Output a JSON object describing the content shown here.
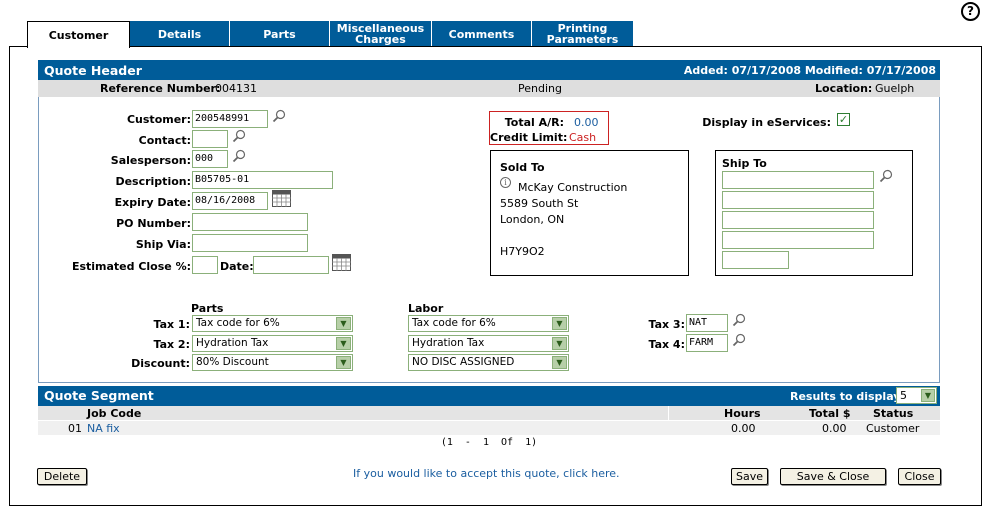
{
  "help_icon": "?",
  "tabs": [
    {
      "label": "Customer",
      "active": true
    },
    {
      "label": "Details",
      "active": false
    },
    {
      "label": "Parts",
      "active": false
    },
    {
      "label": "Miscellaneous\nCharges",
      "active": false
    },
    {
      "label": "Comments",
      "active": false
    },
    {
      "label": "Printing\nParameters",
      "active": false
    }
  ],
  "header": {
    "title": "Quote Header",
    "added_label": "Added:",
    "added_value": "07/17/2008",
    "modified_label": "Modified:",
    "modified_value": "07/17/2008",
    "reference_label": "Reference Number:",
    "reference_value": "004131",
    "status": "Pending",
    "location_label": "Location:",
    "location_value": "Guelph"
  },
  "form": {
    "customer_label": "Customer:",
    "customer_value": "200548991",
    "contact_label": "Contact:",
    "contact_value": "",
    "salesperson_label": "Salesperson:",
    "salesperson_value": "000",
    "description_label": "Description:",
    "description_value": "B05705-01",
    "expiry_label": "Expiry Date:",
    "expiry_value": "08/16/2008",
    "po_label": "PO Number:",
    "po_value": "",
    "shipvia_label": "Ship Via:",
    "shipvia_value": "",
    "estclose_label": "Estimated Close %:",
    "estclose_value": "",
    "date_label": "Date:",
    "date_value": ""
  },
  "ar": {
    "total_label": "Total A/R:",
    "total_value": "0.00",
    "credit_label": "Credit Limit:",
    "credit_value": "Cash"
  },
  "eservices_label": "Display in eServices:",
  "eservices_checked": true,
  "sold_to": {
    "title": "Sold To",
    "name": "McKay Construction",
    "line1": "5589 South St",
    "line2": "London, ON",
    "line3": "",
    "postal": "H7Y9O2"
  },
  "ship_to": {
    "title": "Ship To",
    "lines": [
      "",
      "",
      "",
      "",
      ""
    ]
  },
  "tax": {
    "parts_heading": "Parts",
    "labor_heading": "Labor",
    "tax1_label": "Tax 1:",
    "tax2_label": "Tax 2:",
    "discount_label": "Discount:",
    "parts_tax1": "Tax code for 6%",
    "parts_tax2": "Hydration Tax",
    "parts_discount": "80% Discount",
    "labor_tax1": "Tax code for 6%",
    "labor_tax2": "Hydration Tax",
    "labor_discount": "NO DISC ASSIGNED",
    "tax3_label": "Tax 3:",
    "tax3_value": "NAT",
    "tax4_label": "Tax 4:",
    "tax4_value": "FARM"
  },
  "segment": {
    "title": "Quote Segment",
    "results_label": "Results to display:",
    "results_value": "5",
    "columns": {
      "job_code": "Job Code",
      "hours": "Hours",
      "total": "Total $",
      "status": "Status"
    },
    "rows": [
      {
        "num": "01",
        "job": "NA fix",
        "hours": "0.00",
        "total": "0.00",
        "status": "Customer"
      }
    ],
    "pager": "(1  -  1  Of  1)"
  },
  "footer": {
    "delete_label": "Delete",
    "accept_text": "If you would like to accept this quote, click here.",
    "save_label": "Save",
    "save_close_label": "Save & Close",
    "close_label": "Close"
  },
  "colors": {
    "brand": "#005c99",
    "field_border": "#8bb07a",
    "link": "#1b5ea0",
    "alert": "#cc2222"
  }
}
